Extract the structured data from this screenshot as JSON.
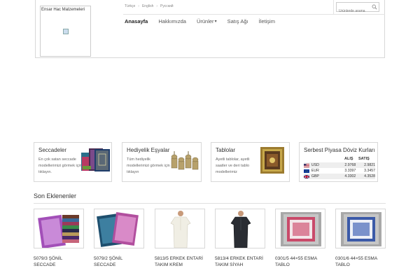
{
  "header": {
    "logo_alt": "Ensar Hac Malzemeleri",
    "languages": [
      "Türkçe",
      "English",
      "Русский"
    ],
    "search_placeholder": "Ürünlerde arama",
    "nav": [
      {
        "label": "Anasayfa",
        "active": true
      },
      {
        "label": "Hakkımızda",
        "active": false
      },
      {
        "label": "Ürünler",
        "active": false,
        "dropdown": true
      },
      {
        "label": "Satış Ağı",
        "active": false
      },
      {
        "label": "İletişim",
        "active": false
      }
    ]
  },
  "features": [
    {
      "title": "Seccadeler",
      "desc": "En çok satan seccade modellerimizi görmek için tıklayın."
    },
    {
      "title": "Hediyelik Eşyalar",
      "desc": "Tüm hediyelik modellerimizi görmek için tıklayın"
    },
    {
      "title": "Tablolar",
      "desc": "Ayetli tablolar, ayetli saatler ve deri tablo modellerimiz"
    }
  ],
  "currency": {
    "title": "Serbest Piyasa Döviz Kurları",
    "buy_label": "ALIŞ",
    "sell_label": "SATIŞ",
    "rows": [
      {
        "code": "USD",
        "buy": "2.9768",
        "sell": "2.9821"
      },
      {
        "code": "EUR",
        "buy": "3.3397",
        "sell": "3.3457"
      },
      {
        "code": "GBP",
        "buy": "4.3302",
        "sell": "4.3528"
      }
    ]
  },
  "recent": {
    "title": "Son Eklenenler",
    "products": [
      {
        "line1": "5079/3 ŞÖNİL",
        "line2": "SECCADE"
      },
      {
        "line1": "5079/2 ŞÖNİL",
        "line2": "SECCADE"
      },
      {
        "line1": "5813/5 ERKEK ENTARİ",
        "line2": "TAKIM KREM"
      },
      {
        "line1": "5813/4 ERKEK ENTARİ",
        "line2": "TAKIM SİYAH"
      },
      {
        "line1": "0301/5 44×55 ESMA",
        "line2": "TABLO"
      },
      {
        "line1": "0301/6 44×55 ESMA",
        "line2": "TABLO"
      }
    ]
  },
  "colors": {
    "border": "#d8d8d8",
    "text": "#333333",
    "muted": "#888888"
  }
}
